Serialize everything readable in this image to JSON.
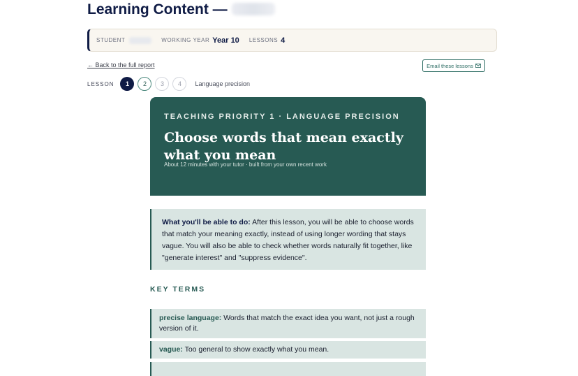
{
  "header": {
    "title": "Learning Content —"
  },
  "info": {
    "student_label": "STUDENT",
    "year_label": "WORKING YEAR",
    "year_value": "Year 10",
    "lessons_label": "LESSONS",
    "lessons_value": "4"
  },
  "nav": {
    "back_link": "← Back to the full report",
    "email_button": "Email these lessons",
    "lesson_label": "LESSON",
    "steps": [
      "1",
      "2",
      "3",
      "4"
    ],
    "current_name": "Language precision"
  },
  "hero": {
    "kicker": "TEACHING PRIORITY 1 · LANGUAGE PRECISION",
    "headline": "Choose words that mean exactly what you mean",
    "subtitle": "About 12 minutes with your tutor · built from your own recent work"
  },
  "objective": {
    "lead": "What you'll be able to do:",
    "text": " After this lesson, you will be able to choose words that match your meaning exactly, instead of using longer wording that stays vague. You will also be able to check whether words naturally fit together, like \"generate interest\" and \"suppress evidence\"."
  },
  "key_terms": {
    "heading": "KEY TERMS",
    "items": [
      {
        "term": "precise language:",
        "definition": " Words that match the exact idea you want, not just a rough version of it."
      },
      {
        "term": "vague:",
        "definition": " Too general to show exactly what you mean."
      }
    ]
  },
  "colors": {
    "navy": "#0f1b45",
    "teal": "#275a53",
    "mint": "#d9e5e2",
    "cream": "#f9f6f0"
  }
}
